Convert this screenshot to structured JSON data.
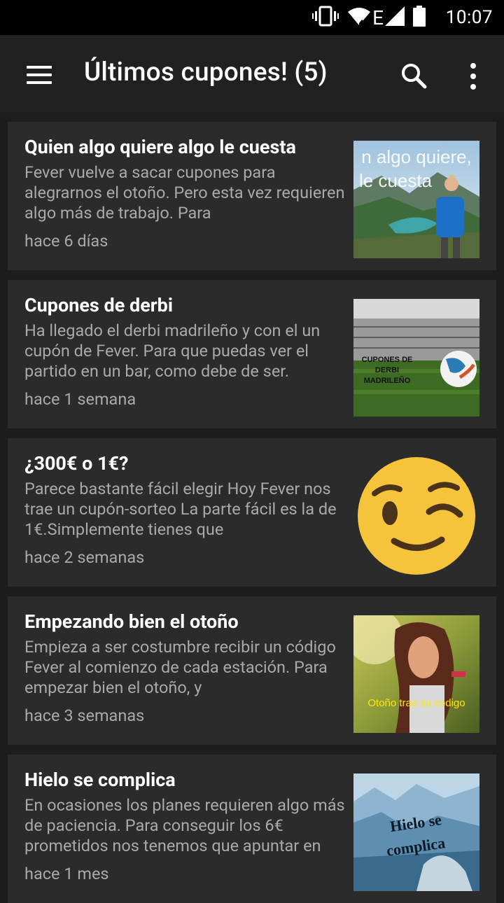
{
  "status_bar": {
    "time": "10:07",
    "network_label": "E",
    "icons": [
      "vibrate-icon",
      "wifi-icon",
      "signal-icon",
      "battery-icon"
    ]
  },
  "app_bar": {
    "title": "Últimos cupones! (5)",
    "icons": [
      "menu-icon",
      "search-icon",
      "more-vert-icon"
    ]
  },
  "coupons": [
    {
      "title": "Quien algo quiere algo le cuesta",
      "description": "Fever vuelve a sacar cupones para alegrarnos el otoño. Pero esta vez requieren algo más de trabajo. Para",
      "time": "hace 6 días",
      "thumb_text": "n algo quiere, le cuesta"
    },
    {
      "title": "Cupones de derbi",
      "description": "Ha llegado el derbi madrileño y con el un cupón de Fever. Para que puedas ver el partido en un bar, como debe de ser.",
      "time": "hace 1 semana",
      "thumb_text": "CUPONES DE DERBI MADRILEÑO"
    },
    {
      "title": "¿300€ o 1€?",
      "description": "Parece bastante fácil elegir Hoy Fever nos trae un cupón-sorteo La parte fácil es la de 1€.Simplemente tienes que",
      "time": "hace 2 semanas",
      "thumb_text": ""
    },
    {
      "title": "Empezando bien el otoño",
      "description": "Empieza a ser costumbre recibir un código Fever al comienzo de cada estación. Para empezar bien el otoño, y",
      "time": "hace 3 semanas",
      "thumb_text": "Otoño trae su codigo"
    },
    {
      "title": "Hielo se complica",
      "description": "En ocasiones los planes requieren algo más de paciencia. Para conseguir los 6€ prometidos nos tenemos que apuntar en",
      "time": "hace 1 mes",
      "thumb_text": "Hielo se complica"
    }
  ],
  "colors": {
    "background": "#1d1d1d",
    "app_bar": "#212121",
    "card": "#2b2b2b",
    "title_text": "#ffffff",
    "secondary_text": "#a9a9a9"
  }
}
